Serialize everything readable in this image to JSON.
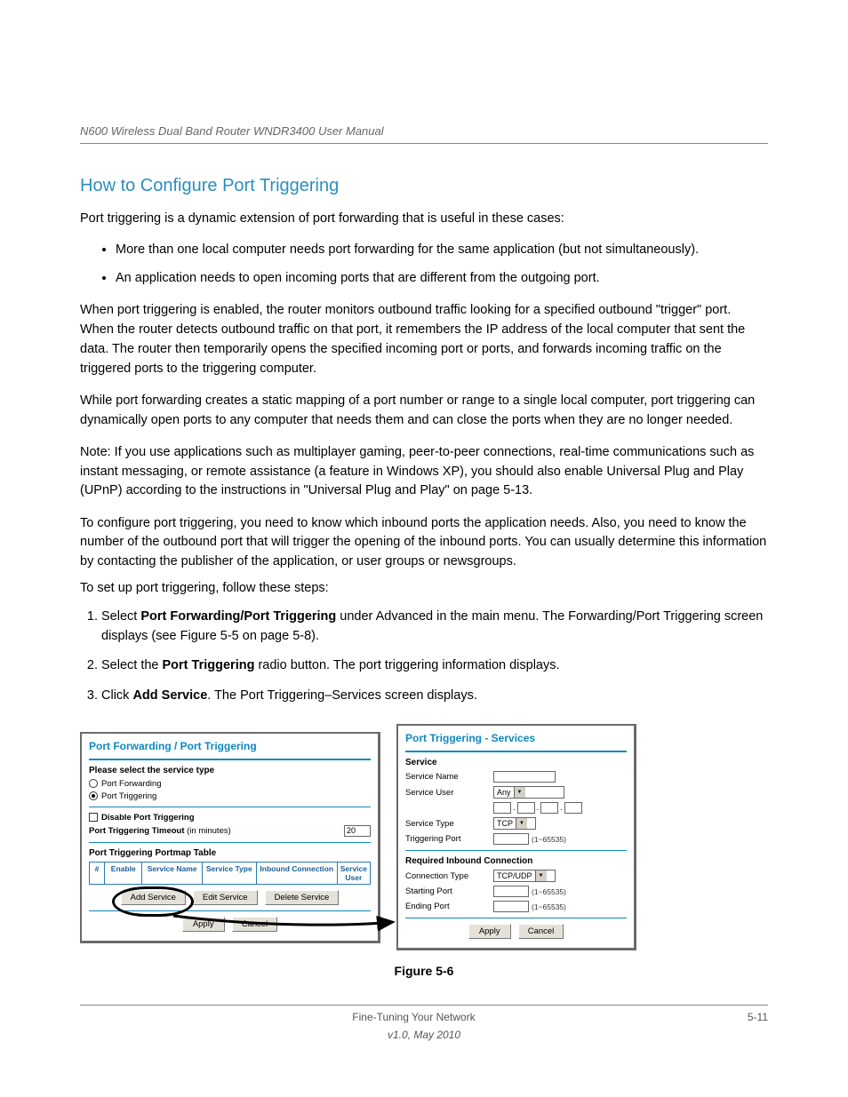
{
  "header": {
    "title_left": "N600 Wireless Dual Band Router WNDR3400 User Manual",
    "title_right": ""
  },
  "section_title": "How to Configure Port Triggering",
  "intro": {
    "p1": "Port triggering is a dynamic extension of port forwarding that is useful in these cases:",
    "bullets": [
      "More than one local computer needs port forwarding for the same application (but not simultaneously).",
      "An application needs to open incoming ports that are different from the outgoing port."
    ],
    "p2": "When port triggering is enabled, the router monitors outbound traffic looking for a specified outbound \"trigger\" port. When the router detects outbound traffic on that port, it remembers the IP address of the local computer that sent the data. The router then temporarily opens the specified incoming port or ports, and forwards incoming traffic on the triggered ports to the triggering computer.",
    "p3": "While port forwarding creates a static mapping of a port number or range to a single local computer, port triggering can dynamically open ports to any computer that needs them and can close the ports when they are no longer needed.",
    "note": "Note: If you use applications such as multiplayer gaming, peer-to-peer connections, real-time communications such as instant messaging, or remote assistance (a feature in Windows XP), you should also enable Universal Plug and Play (UPnP) according to the instructions in \"Universal Plug and Play\" on page 5-13."
  },
  "steps_lead": "To configure port triggering, you need to know which inbound ports the application needs. Also, you need to know the number of the outbound port that will trigger the opening of the inbound ports. You can usually determine this information by contacting the publisher of the application, or user groups or newsgroups.",
  "follow_steps": "To set up port triggering, follow these steps:",
  "step1": {
    "prefix": "Select ",
    "bold": "Port Forwarding/Port Triggering",
    "middle": " under Advanced in the main menu. The Forwarding/Port Triggering screen displays (see ",
    "figref": "Figure 5-5 on page 5-8",
    "suffix": ")."
  },
  "step2": {
    "prefix": "Select the ",
    "bold": "Port Triggering",
    "suffix": " radio button. The port triggering information displays."
  },
  "step3": {
    "prefix": "Click ",
    "bold": "Add Service",
    "suffix": ". The Port Triggering–Services screen displays."
  },
  "left_panel": {
    "title": "Port Forwarding / Port Triggering",
    "subhead": "Please select the service type",
    "radio_pf": "Port Forwarding",
    "radio_pt": "Port Triggering",
    "disable_pt": "Disable Port Triggering",
    "timeout_label": "Port Triggering Timeout",
    "timeout_unit": "(in minutes)",
    "timeout_value": "20",
    "portmap_title": "Port Triggering Portmap Table",
    "th_hash": "#",
    "th_enable": "Enable",
    "th_sn": "Service Name",
    "th_st": "Service Type",
    "th_ic": "Inbound Connection",
    "th_su": "Service User",
    "btn_add": "Add Service",
    "btn_edit": "Edit Service",
    "btn_delete": "Delete Service",
    "btn_apply": "Apply",
    "btn_cancel": "Cancel"
  },
  "right_panel": {
    "title": "Port Triggering - Services",
    "service_head": "Service",
    "service_name": "Service Name",
    "service_user": "Service User",
    "service_user_val": "Any",
    "service_type": "Service Type",
    "service_type_val": "TCP",
    "triggering_port": "Triggering Port",
    "range_hint": "(1~65535)",
    "inbound_head": "Required Inbound Connection",
    "conn_type": "Connection Type",
    "conn_type_val": "TCP/UDP",
    "starting_port": "Starting Port",
    "ending_port": "Ending Port",
    "btn_apply": "Apply",
    "btn_cancel": "Cancel"
  },
  "figure_caption": "Figure 5-6",
  "footer": {
    "center": "Fine-Tuning Your Network",
    "right": "5-11",
    "rev": "v1.0, May 2010"
  }
}
